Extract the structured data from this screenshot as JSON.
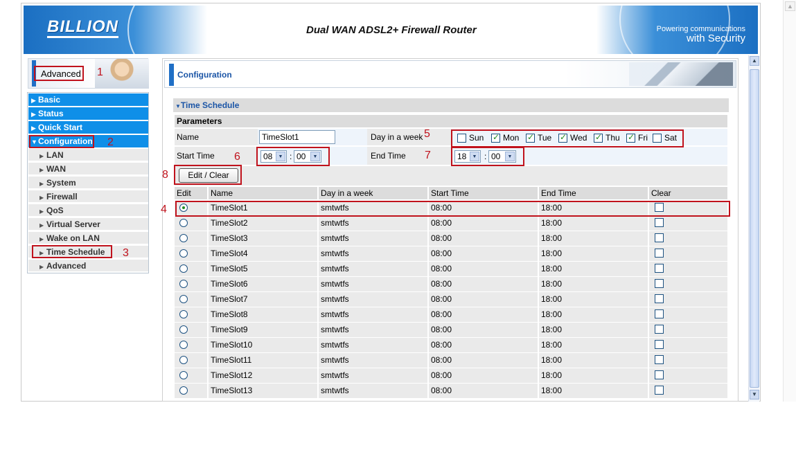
{
  "banner": {
    "logo": "BILLION",
    "title": "Dual WAN ADSL2+ Firewall Router",
    "tagline_1": "Powering communications",
    "tagline_2": "with Security"
  },
  "sidebar": {
    "mode_label": "Advanced",
    "menu": [
      {
        "label": "Basic",
        "level": "top"
      },
      {
        "label": "Status",
        "level": "top"
      },
      {
        "label": "Quick Start",
        "level": "top"
      },
      {
        "label": "Configuration",
        "level": "top",
        "expanded": true
      },
      {
        "label": "LAN",
        "level": "sub"
      },
      {
        "label": "WAN",
        "level": "sub"
      },
      {
        "label": "System",
        "level": "sub"
      },
      {
        "label": "Firewall",
        "level": "sub"
      },
      {
        "label": "QoS",
        "level": "sub"
      },
      {
        "label": "Virtual Server",
        "level": "sub"
      },
      {
        "label": "Wake on LAN",
        "level": "sub"
      },
      {
        "label": "Time Schedule",
        "level": "sub",
        "selected": true
      },
      {
        "label": "Advanced",
        "level": "sub"
      }
    ]
  },
  "main": {
    "header": "Configuration",
    "section_title": "Time Schedule",
    "params_label": "Parameters",
    "name_label": "Name",
    "name_value": "TimeSlot1",
    "day_label": "Day in a week",
    "days": [
      {
        "label": "Sun",
        "checked": false
      },
      {
        "label": "Mon",
        "checked": true
      },
      {
        "label": "Tue",
        "checked": true
      },
      {
        "label": "Wed",
        "checked": true
      },
      {
        "label": "Thu",
        "checked": true
      },
      {
        "label": "Fri",
        "checked": true
      },
      {
        "label": "Sat",
        "checked": false
      }
    ],
    "start_label": "Start Time",
    "start_hour": "08",
    "start_min": "00",
    "end_label": "End Time",
    "end_hour": "18",
    "end_min": "00",
    "time_sep": ":",
    "edit_button": "Edit / Clear",
    "table": {
      "headers": [
        "Edit",
        "Name",
        "Day in a week",
        "Start Time",
        "End Time",
        "Clear"
      ],
      "rows": [
        {
          "name": "TimeSlot1",
          "days": "smtwtfs",
          "start": "08:00",
          "end": "18:00",
          "selected": true
        },
        {
          "name": "TimeSlot2",
          "days": "smtwtfs",
          "start": "08:00",
          "end": "18:00"
        },
        {
          "name": "TimeSlot3",
          "days": "smtwtfs",
          "start": "08:00",
          "end": "18:00"
        },
        {
          "name": "TimeSlot4",
          "days": "smtwtfs",
          "start": "08:00",
          "end": "18:00"
        },
        {
          "name": "TimeSlot5",
          "days": "smtwtfs",
          "start": "08:00",
          "end": "18:00"
        },
        {
          "name": "TimeSlot6",
          "days": "smtwtfs",
          "start": "08:00",
          "end": "18:00"
        },
        {
          "name": "TimeSlot7",
          "days": "smtwtfs",
          "start": "08:00",
          "end": "18:00"
        },
        {
          "name": "TimeSlot8",
          "days": "smtwtfs",
          "start": "08:00",
          "end": "18:00"
        },
        {
          "name": "TimeSlot9",
          "days": "smtwtfs",
          "start": "08:00",
          "end": "18:00"
        },
        {
          "name": "TimeSlot10",
          "days": "smtwtfs",
          "start": "08:00",
          "end": "18:00"
        },
        {
          "name": "TimeSlot11",
          "days": "smtwtfs",
          "start": "08:00",
          "end": "18:00"
        },
        {
          "name": "TimeSlot12",
          "days": "smtwtfs",
          "start": "08:00",
          "end": "18:00"
        },
        {
          "name": "TimeSlot13",
          "days": "smtwtfs",
          "start": "08:00",
          "end": "18:00"
        }
      ]
    }
  },
  "annotations": [
    "1",
    "2",
    "3",
    "4",
    "5",
    "6",
    "7",
    "8"
  ],
  "colors": {
    "accent": "#0f8fe8",
    "annotation": "#c0121c",
    "header_text": "#1b55a6"
  }
}
